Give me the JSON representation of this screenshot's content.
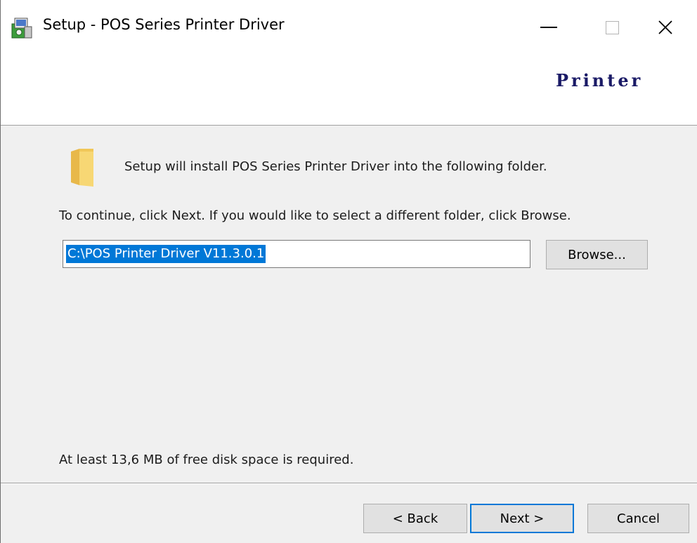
{
  "window": {
    "title": "Setup - POS Series Printer Driver",
    "icons": {
      "app": "setup-installer-icon",
      "minimize": "minimize-icon",
      "maximize": "maximize-icon",
      "close": "close-icon"
    }
  },
  "header": {
    "logo_text": "Printer",
    "logo_color": "#1a1a66"
  },
  "body": {
    "intro": "Setup will install POS Series Printer Driver into the following folder.",
    "instructions": "To continue, click Next. If you would like to select a different folder, click Browse.",
    "path_value": "C:\\POS Printer Driver V11.3.0.1",
    "browse_label": "Browse...",
    "disk_space": "At least 13,6 MB of free disk space is required.",
    "folder_icon": "folder-icon",
    "selection_color": "#0078d7"
  },
  "footer": {
    "back_label": "< Back",
    "next_label": "Next >",
    "cancel_label": "Cancel"
  }
}
